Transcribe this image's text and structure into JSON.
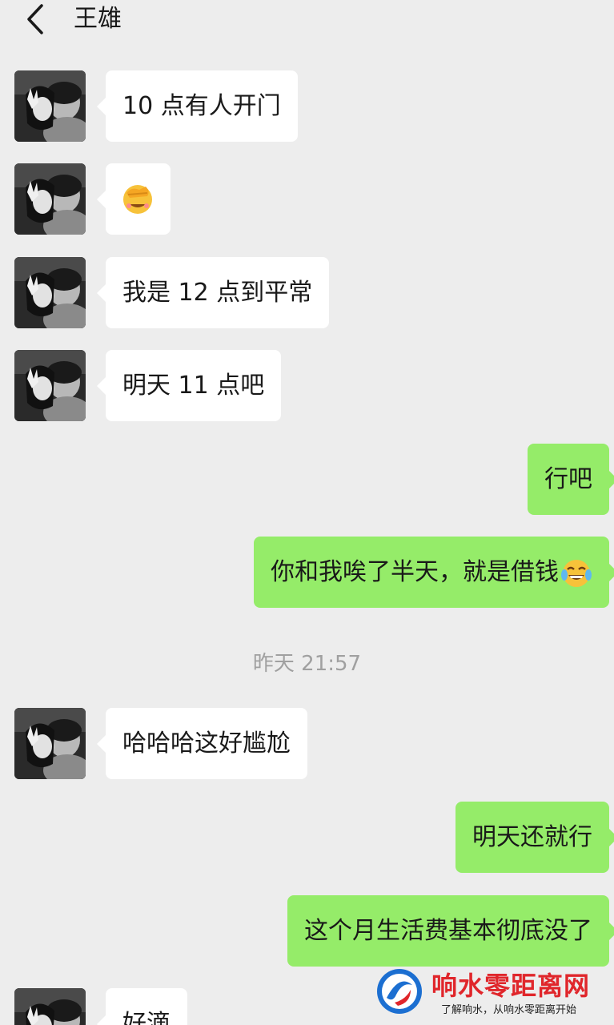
{
  "header": {
    "title": "王雄",
    "back_icon": "chevron-left-icon"
  },
  "messages": [
    {
      "side": "in",
      "text": "10 点有人开门"
    },
    {
      "side": "in",
      "emoji": "face-palm-emoji"
    },
    {
      "side": "in",
      "text": "我是 12 点到平常"
    },
    {
      "side": "in",
      "text": "明天 11 点吧"
    },
    {
      "side": "out",
      "text": "行吧"
    },
    {
      "side": "out",
      "text": "你和我唉了半天，就是借钱",
      "emoji": "tears-of-joy-emoji"
    },
    {
      "timestamp": "昨天 21:57"
    },
    {
      "side": "in",
      "text": "哈哈哈这好尴尬"
    },
    {
      "side": "out",
      "text": "明天还就行"
    },
    {
      "side": "out",
      "text": "这个月生活费基本彻底没了"
    },
    {
      "side": "in",
      "text": "好滴"
    }
  ],
  "watermark": {
    "title": "响水零距离网",
    "subtitle": "了解响水，从响水零距离开始"
  },
  "colors": {
    "background": "#ededed",
    "incoming_bubble": "#ffffff",
    "outgoing_bubble": "#95ec69",
    "timestamp": "#a0a0a0",
    "watermark_red": "#e0262b"
  }
}
